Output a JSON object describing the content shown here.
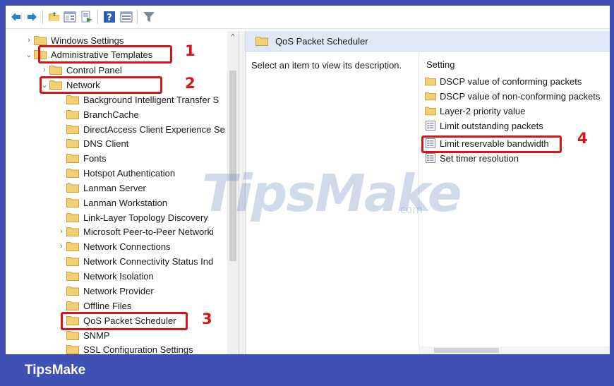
{
  "toolbar": {
    "buttons": [
      "back-arrow-icon",
      "forward-arrow-icon",
      "open-folder-icon",
      "show-hide-tree-icon",
      "export-list-icon",
      "help-icon",
      "properties-icon",
      "filter-icon"
    ]
  },
  "tree": {
    "items": [
      {
        "label": "Windows Settings",
        "arrow": "›"
      },
      {
        "label": "Administrative Templates",
        "arrow": "⌄"
      },
      {
        "label": "Control Panel",
        "arrow": "›"
      },
      {
        "label": "Network",
        "arrow": "⌄"
      },
      {
        "label": "Background Intelligent Transfer S",
        "arrow": ""
      },
      {
        "label": "BranchCache",
        "arrow": ""
      },
      {
        "label": "DirectAccess Client Experience Se",
        "arrow": ""
      },
      {
        "label": "DNS Client",
        "arrow": ""
      },
      {
        "label": "Fonts",
        "arrow": ""
      },
      {
        "label": "Hotspot Authentication",
        "arrow": ""
      },
      {
        "label": "Lanman Server",
        "arrow": ""
      },
      {
        "label": "Lanman Workstation",
        "arrow": ""
      },
      {
        "label": "Link-Layer Topology Discovery",
        "arrow": ""
      },
      {
        "label": "Microsoft Peer-to-Peer Networki",
        "arrow": "›"
      },
      {
        "label": "Network Connections",
        "arrow": "›"
      },
      {
        "label": "Network Connectivity Status Ind",
        "arrow": ""
      },
      {
        "label": "Network Isolation",
        "arrow": ""
      },
      {
        "label": "Network Provider",
        "arrow": ""
      },
      {
        "label": "Offline Files",
        "arrow": ""
      },
      {
        "label": "QoS Packet Scheduler",
        "arrow": ""
      },
      {
        "label": "SNMP",
        "arrow": ""
      },
      {
        "label": "SSL Configuration Settings",
        "arrow": ""
      }
    ],
    "scroll_up_glyph": "^"
  },
  "right_pane": {
    "title": "QoS Packet Scheduler",
    "description": "Select an item to view its description.",
    "column_header": "Setting",
    "settings": [
      {
        "label": "DSCP value of conforming packets",
        "icon": "folder-icon"
      },
      {
        "label": "DSCP value of non-conforming packets",
        "icon": "folder-icon"
      },
      {
        "label": "Layer-2 priority value",
        "icon": "folder-icon"
      },
      {
        "label": "Limit outstanding packets",
        "icon": "policy-setting-icon"
      },
      {
        "label": "Limit reservable bandwidth",
        "icon": "policy-setting-icon"
      },
      {
        "label": "Set timer resolution",
        "icon": "policy-setting-icon"
      }
    ]
  },
  "annotations": {
    "step1": "1",
    "step2": "2",
    "step3": "3",
    "step4": "4",
    "highlight_color": "#d6151b"
  },
  "watermark": {
    "main": "TipsMake",
    "suffix": ".com"
  },
  "footer": {
    "brand": "TipsMake",
    "color": "#3f51b5"
  }
}
